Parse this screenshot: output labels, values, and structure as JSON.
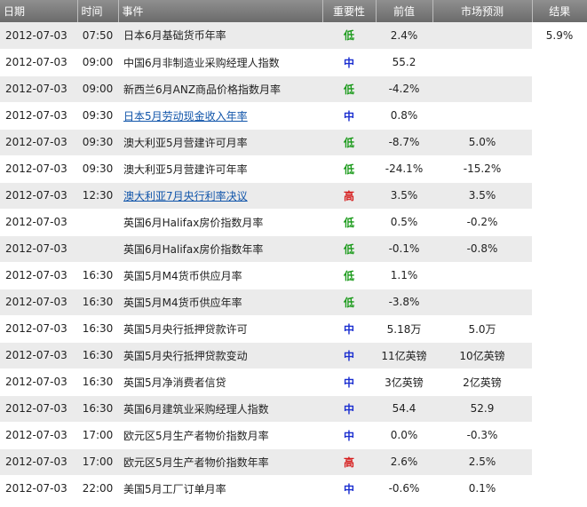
{
  "headers": {
    "date": "日期",
    "time": "时间",
    "event": "事件",
    "importance": "重要性",
    "previous": "前值",
    "forecast": "市场预测",
    "result": "结果"
  },
  "importance_colors": {
    "低": "#1a9a1a",
    "中": "#1a2ed0",
    "高": "#d61c1c"
  },
  "rows": [
    {
      "date": "2012-07-03",
      "time": "07:50",
      "event": "日本6月基础货币年率",
      "link": false,
      "importance": "低",
      "previous": "2.4%",
      "forecast": "",
      "result": "5.9%"
    },
    {
      "date": "2012-07-03",
      "time": "09:00",
      "event": "中国6月非制造业采购经理人指数",
      "link": false,
      "importance": "中",
      "previous": "55.2",
      "forecast": "",
      "result": ""
    },
    {
      "date": "2012-07-03",
      "time": "09:00",
      "event": "新西兰6月ANZ商品价格指数月率",
      "link": false,
      "importance": "低",
      "previous": "-4.2%",
      "forecast": "",
      "result": ""
    },
    {
      "date": "2012-07-03",
      "time": "09:30",
      "event": "日本5月劳动现金收入年率",
      "link": true,
      "importance": "中",
      "previous": "0.8%",
      "forecast": "",
      "result": ""
    },
    {
      "date": "2012-07-03",
      "time": "09:30",
      "event": "澳大利亚5月营建许可月率",
      "link": false,
      "importance": "低",
      "previous": "-8.7%",
      "forecast": "5.0%",
      "result": ""
    },
    {
      "date": "2012-07-03",
      "time": "09:30",
      "event": "澳大利亚5月营建许可年率",
      "link": false,
      "importance": "低",
      "previous": "-24.1%",
      "forecast": "-15.2%",
      "result": ""
    },
    {
      "date": "2012-07-03",
      "time": "12:30",
      "event": "澳大利亚7月央行利率决议",
      "link": true,
      "importance": "高",
      "previous": "3.5%",
      "forecast": "3.5%",
      "result": ""
    },
    {
      "date": "2012-07-03",
      "time": "",
      "event": "英国6月Halifax房价指数月率",
      "link": false,
      "importance": "低",
      "previous": "0.5%",
      "forecast": "-0.2%",
      "result": ""
    },
    {
      "date": "2012-07-03",
      "time": "",
      "event": "英国6月Halifax房价指数年率",
      "link": false,
      "importance": "低",
      "previous": "-0.1%",
      "forecast": "-0.8%",
      "result": ""
    },
    {
      "date": "2012-07-03",
      "time": "16:30",
      "event": "英国5月M4货币供应月率",
      "link": false,
      "importance": "低",
      "previous": "1.1%",
      "forecast": "",
      "result": ""
    },
    {
      "date": "2012-07-03",
      "time": "16:30",
      "event": "英国5月M4货币供应年率",
      "link": false,
      "importance": "低",
      "previous": "-3.8%",
      "forecast": "",
      "result": ""
    },
    {
      "date": "2012-07-03",
      "time": "16:30",
      "event": "英国5月央行抵押贷款许可",
      "link": false,
      "importance": "中",
      "previous": "5.18万",
      "forecast": "5.0万",
      "result": ""
    },
    {
      "date": "2012-07-03",
      "time": "16:30",
      "event": "英国5月央行抵押贷款变动",
      "link": false,
      "importance": "中",
      "previous": "11亿英镑",
      "forecast": "10亿英镑",
      "result": ""
    },
    {
      "date": "2012-07-03",
      "time": "16:30",
      "event": "英国5月净消费者信贷",
      "link": false,
      "importance": "中",
      "previous": "3亿英镑",
      "forecast": "2亿英镑",
      "result": ""
    },
    {
      "date": "2012-07-03",
      "time": "16:30",
      "event": "英国6月建筑业采购经理人指数",
      "link": false,
      "importance": "中",
      "previous": "54.4",
      "forecast": "52.9",
      "result": ""
    },
    {
      "date": "2012-07-03",
      "time": "17:00",
      "event": "欧元区5月生产者物价指数月率",
      "link": false,
      "importance": "中",
      "previous": "0.0%",
      "forecast": "-0.3%",
      "result": ""
    },
    {
      "date": "2012-07-03",
      "time": "17:00",
      "event": "欧元区5月生产者物价指数年率",
      "link": false,
      "importance": "高",
      "previous": "2.6%",
      "forecast": "2.5%",
      "result": ""
    },
    {
      "date": "2012-07-03",
      "time": "22:00",
      "event": "美国5月工厂订单月率",
      "link": false,
      "importance": "中",
      "previous": "-0.6%",
      "forecast": "0.1%",
      "result": ""
    }
  ]
}
